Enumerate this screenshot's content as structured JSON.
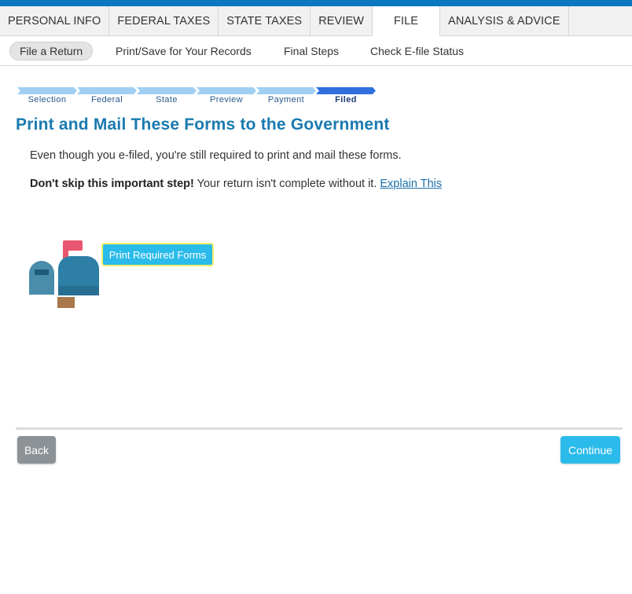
{
  "main_tabs": [
    {
      "label": "PERSONAL INFO"
    },
    {
      "label": "FEDERAL TAXES"
    },
    {
      "label": "STATE TAXES"
    },
    {
      "label": "REVIEW"
    },
    {
      "label": "FILE",
      "active": true
    },
    {
      "label": "ANALYSIS & ADVICE"
    }
  ],
  "sub_tabs": [
    {
      "label": "File a Return",
      "active": true
    },
    {
      "label": "Print/Save for Your Records"
    },
    {
      "label": "Final Steps"
    },
    {
      "label": "Check E-file Status"
    }
  ],
  "progress": {
    "steps": [
      "Selection",
      "Federal",
      "State",
      "Preview",
      "Payment",
      "Filed"
    ],
    "current_step": "Filed"
  },
  "page_title": "Print and Mail These Forms to the Government",
  "body": {
    "line1": "Even though you e-filed, you're still required to print and mail these forms.",
    "line2_bold": "Don't skip this important step!",
    "line2_rest": " Your return isn't complete without it. ",
    "explain_link": "Explain This"
  },
  "icons": {
    "mailbox": "mailbox-icon"
  },
  "buttons": {
    "print_forms": "Print Required Forms",
    "back": "Back",
    "continue": "Continue"
  },
  "colors": {
    "brand_blue": "#0a78be",
    "title_blue": "#1a7ab0",
    "button_cyan": "#2bbbea",
    "focus_yellow": "#f4f06a",
    "back_gray": "#8d9296",
    "progress_done": "#9fd0f3",
    "progress_current": "#2f6fe0"
  }
}
